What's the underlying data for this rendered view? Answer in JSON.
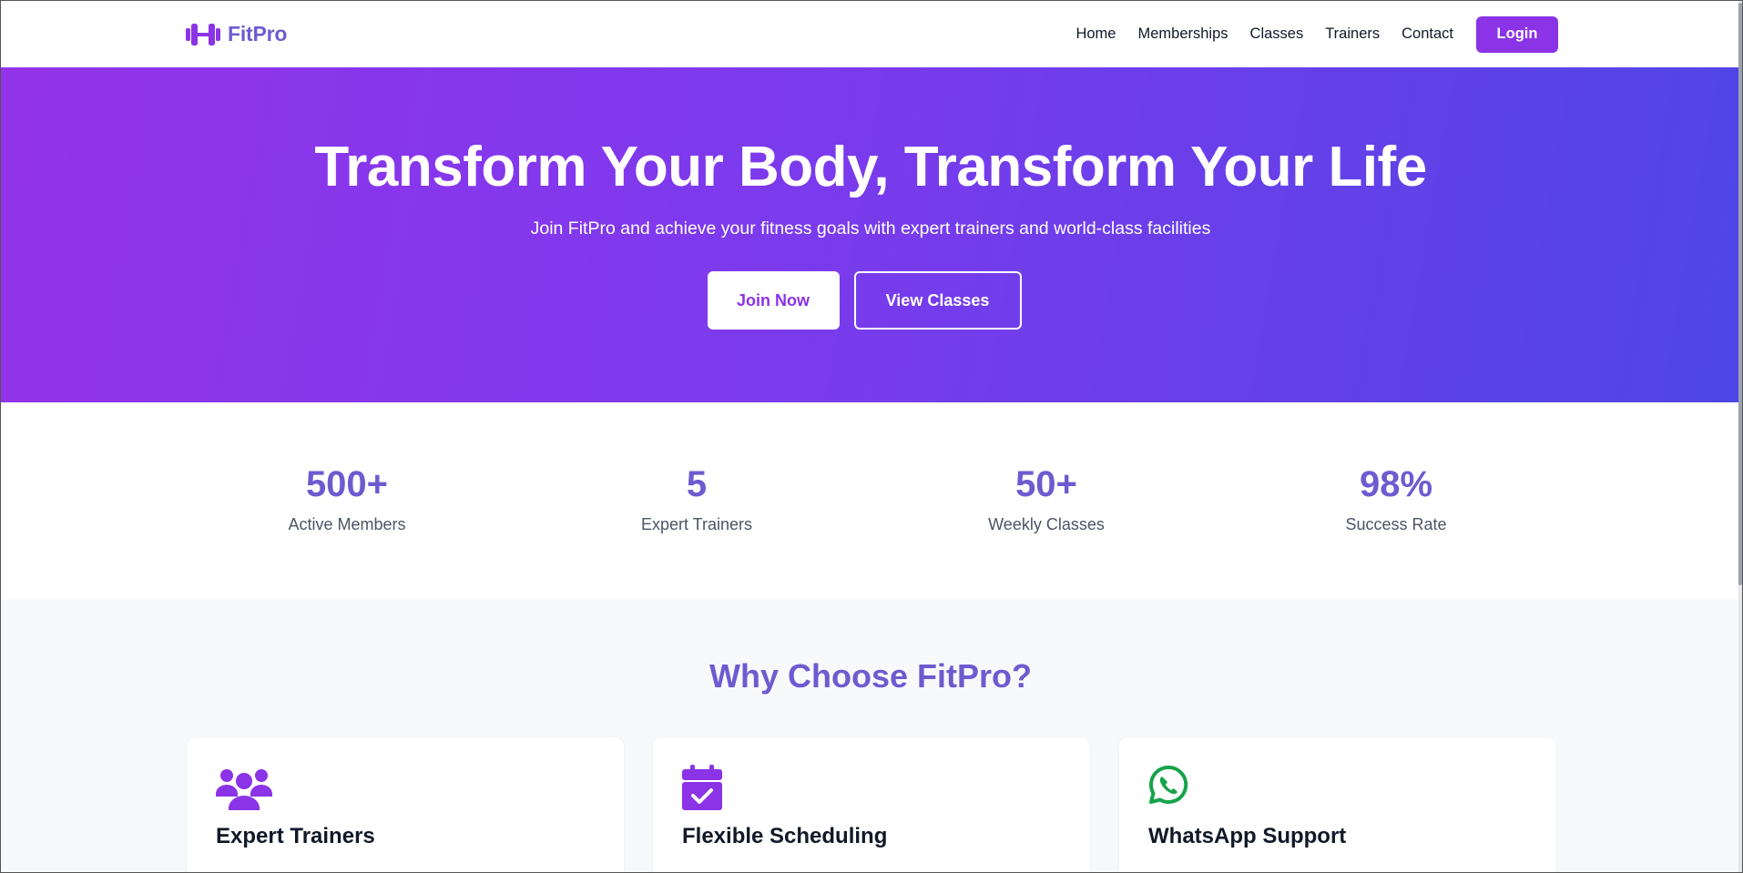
{
  "brand": {
    "name": "FitPro",
    "icon": "dumbbell-icon",
    "color": "#6d5bd0"
  },
  "nav": {
    "links": [
      "Home",
      "Memberships",
      "Classes",
      "Trainers",
      "Contact"
    ],
    "login_label": "Login"
  },
  "hero": {
    "title": "Transform Your Body, Transform Your Life",
    "subtitle": "Join FitPro and achieve your fitness goals with expert trainers and world-class facilities",
    "primary_button": "Join Now",
    "secondary_button": "View Classes",
    "gradient": [
      "#9333ea",
      "#4f46e5"
    ]
  },
  "stats": [
    {
      "value": "500+",
      "label": "Active Members"
    },
    {
      "value": "5",
      "label": "Expert Trainers"
    },
    {
      "value": "50+",
      "label": "Weekly Classes"
    },
    {
      "value": "98%",
      "label": "Success Rate"
    }
  ],
  "why": {
    "title": "Why Choose FitPro?",
    "cards": [
      {
        "icon": "users-icon",
        "title": "Expert Trainers"
      },
      {
        "icon": "calendar-check-icon",
        "title": "Flexible Scheduling"
      },
      {
        "icon": "whatsapp-icon",
        "title": "WhatsApp Support"
      }
    ]
  },
  "colors": {
    "accent": "#8b33e6",
    "heading": "#6d5bd0",
    "whatsapp": "#16a34a"
  }
}
